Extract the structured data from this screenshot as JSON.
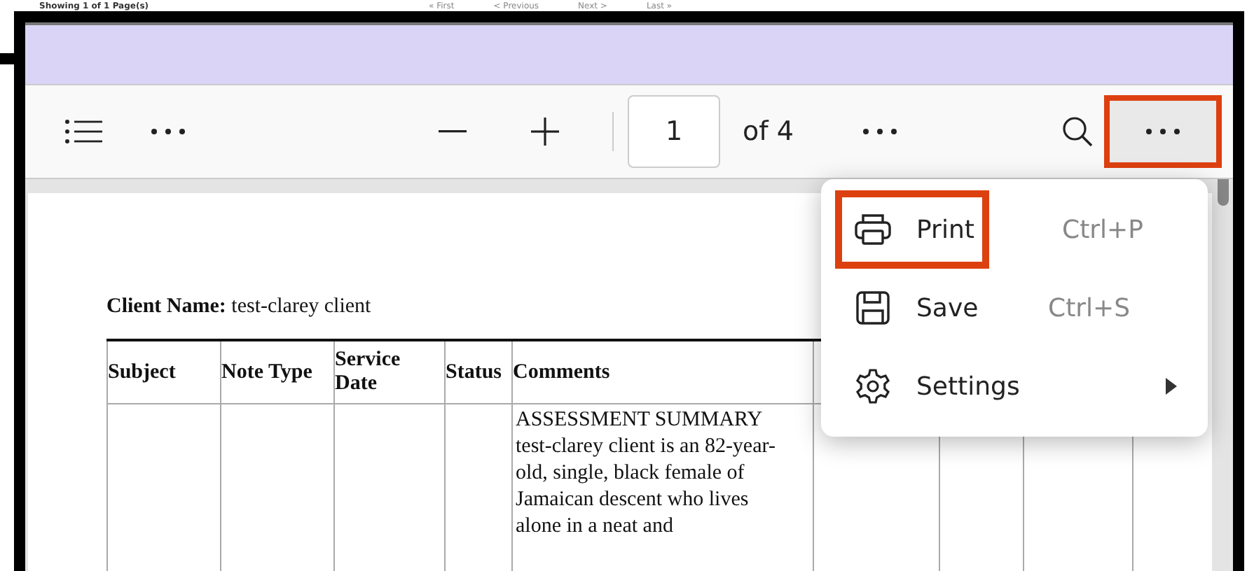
{
  "background_page": {
    "status": "Showing 1 of 1 Page(s)",
    "pager": [
      "« First",
      "< Previous",
      "Next >",
      "Last »"
    ]
  },
  "toolbar": {
    "page_number": "1",
    "page_count": "of 4",
    "more_button": {
      "highlighted": true
    }
  },
  "document": {
    "client_label": "Client Name:",
    "client_name": "test-clarey client",
    "table": {
      "columns": [
        "Subject",
        "Note Type",
        "Service Date",
        "Status",
        "Comments",
        "",
        "",
        ""
      ],
      "rows": [
        [
          "",
          "",
          "",
          "",
          "ASSESSMENT SUMMARY\ntest-clarey client is an 82-year-old, single, black female of Jamaican descent who lives alone in a neat and",
          "",
          "",
          ""
        ]
      ]
    }
  },
  "menu": {
    "items": [
      {
        "kind": "print",
        "label": "Print",
        "shortcut": "Ctrl+P",
        "submenu": false,
        "highlighted": true
      },
      {
        "kind": "save",
        "label": "Save",
        "shortcut": "Ctrl+S",
        "submenu": false,
        "highlighted": false
      },
      {
        "kind": "settings",
        "label": "Settings",
        "submenu": true,
        "highlighted": false
      }
    ]
  }
}
